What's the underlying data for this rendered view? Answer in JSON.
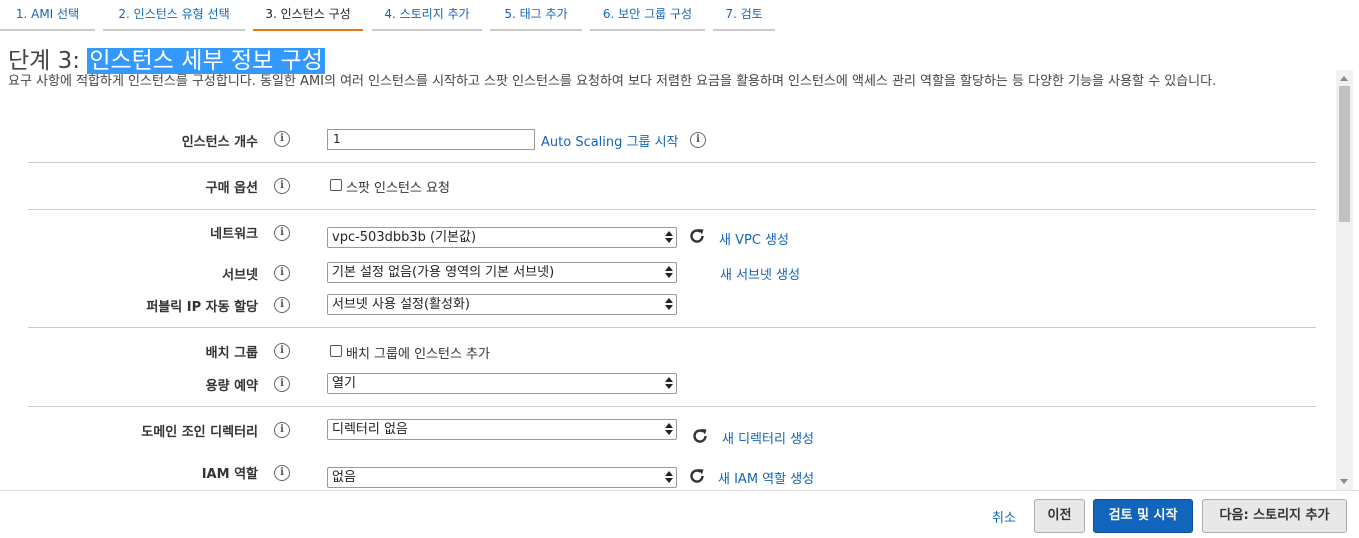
{
  "steps": [
    {
      "label": "1. AMI 선택",
      "active": false
    },
    {
      "label": "2. 인스턴스 유형 선택",
      "active": false
    },
    {
      "label": "3. 인스턴스 구성",
      "active": true
    },
    {
      "label": "4. 스토리지 추가",
      "active": false
    },
    {
      "label": "5. 태그 추가",
      "active": false
    },
    {
      "label": "6. 보안 그룹 구성",
      "active": false
    },
    {
      "label": "7. 검토",
      "active": false
    }
  ],
  "header": {
    "title_prefix": "단계 3: ",
    "title_highlight": "인스턴스 세부 정보 구성",
    "description": "요구 사항에 적합하게 인스턴스를 구성합니다. 동일한 AMI의 여러 인스턴스를 시작하고 스팟 인스턴스를 요청하여 보다 저렴한 요금을 활용하며 인스턴스에 액세스 관리 역할을 할당하는 등 다양한 기능을 사용할 수 있습니다."
  },
  "form": {
    "instance_count": {
      "label": "인스턴스 개수",
      "value": "1",
      "link": "Auto Scaling 그룹 시작"
    },
    "purchase_option": {
      "label": "구매 옵션",
      "checkbox_label": "스팟 인스턴스 요청"
    },
    "network": {
      "label": "네트워크",
      "value": "vpc-503dbb3b (기본값)",
      "link": "새 VPC 생성"
    },
    "subnet": {
      "label": "서브넷",
      "value": "기본 설정 없음(가용 영역의 기본 서브넷)",
      "link": "새 서브넷 생성"
    },
    "public_ip": {
      "label": "퍼블릭 IP 자동 할당",
      "value": "서브넷 사용 설정(활성화)"
    },
    "placement_group": {
      "label": "배치 그룹",
      "checkbox_label": "배치 그룹에 인스턴스 추가"
    },
    "capacity_reservation": {
      "label": "용량 예약",
      "value": "열기"
    },
    "domain_join": {
      "label": "도메인 조인 디렉터리",
      "value": "디렉터리 없음",
      "link": "새 디렉터리 생성"
    },
    "iam_role": {
      "label": "IAM 역할",
      "value": "없음",
      "link": "새 IAM 역할 생성"
    }
  },
  "footer": {
    "cancel": "취소",
    "previous": "이전",
    "review_launch": "검토 및 시작",
    "next": "다음: 스토리지 추가"
  },
  "colors": {
    "link": "#1166bb",
    "active_step_underline": "#e47911",
    "title_highlight": "#3399ff",
    "primary_button": "#1166bb"
  }
}
